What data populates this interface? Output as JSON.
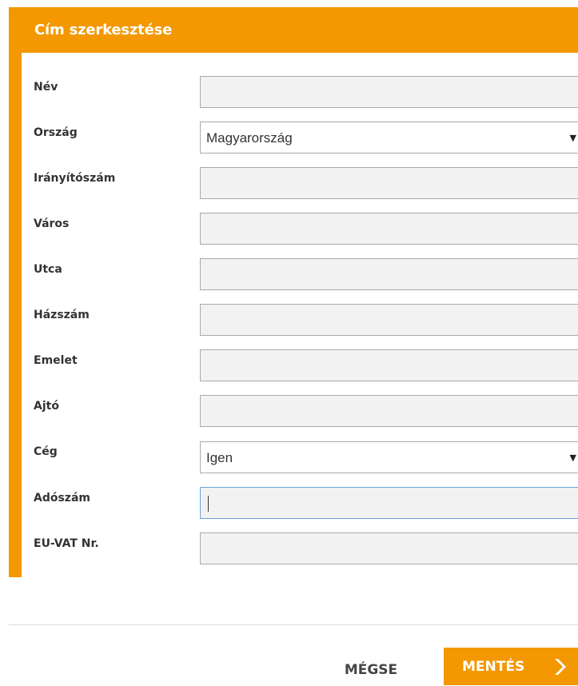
{
  "dialog": {
    "title": "Cím szerkesztése",
    "accent_color": "#f39800"
  },
  "fields": [
    {
      "label": "Név",
      "type": "text",
      "value": ""
    },
    {
      "label": "Ország",
      "type": "select",
      "value": "Magyarország"
    },
    {
      "label": "Irányítószám",
      "type": "text",
      "value": ""
    },
    {
      "label": "Város",
      "type": "text",
      "value": ""
    },
    {
      "label": "Utca",
      "type": "text",
      "value": ""
    },
    {
      "label": "Házszám",
      "type": "text",
      "value": ""
    },
    {
      "label": "Emelet",
      "type": "text",
      "value": ""
    },
    {
      "label": "Ajtó",
      "type": "text",
      "value": ""
    },
    {
      "label": "Cég",
      "type": "select",
      "value": "Igen"
    },
    {
      "label": "Adószám",
      "type": "text",
      "value": "",
      "focused": true
    },
    {
      "label": "EU-VAT Nr.",
      "type": "text",
      "value": ""
    }
  ],
  "icons": {
    "select_arrow": "caret-down-icon",
    "save_arrow": "chevron-right-icon"
  },
  "actions": {
    "cancel_label": "MÉGSE",
    "save_label": "MENTÉS"
  }
}
